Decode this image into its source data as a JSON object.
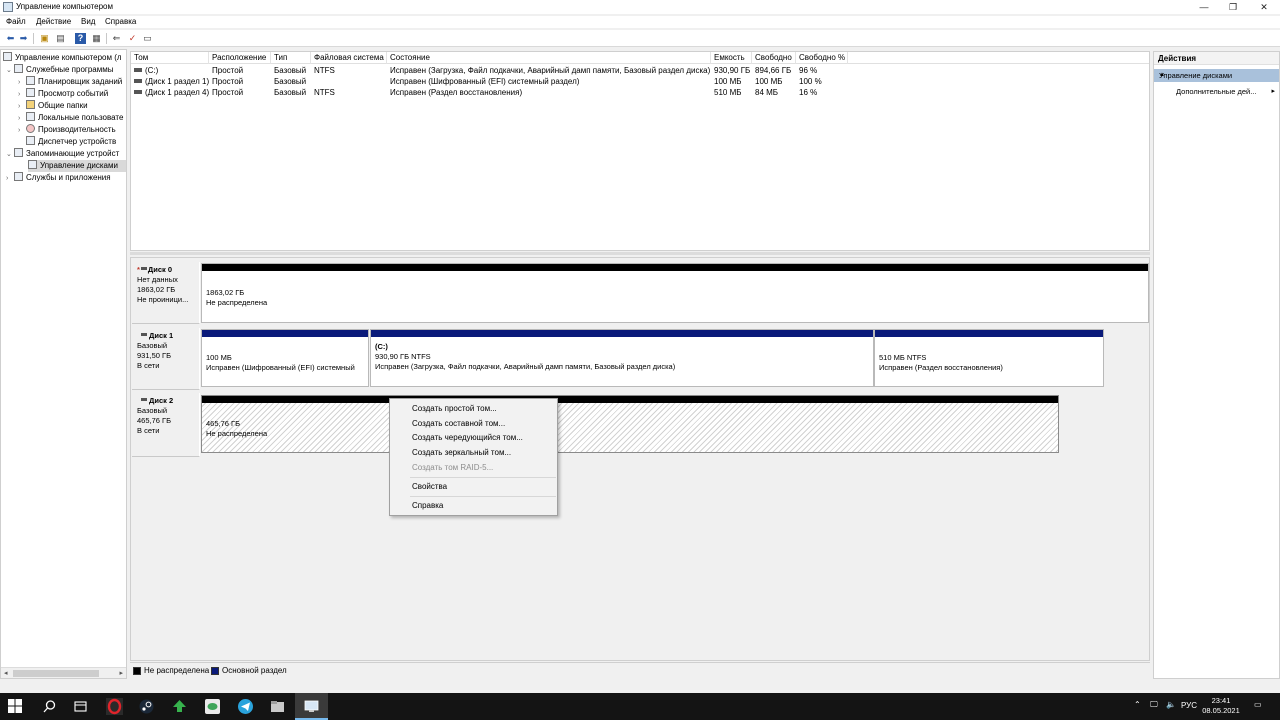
{
  "window": {
    "title": "Управление компьютером",
    "minimize": "—",
    "restore": "❐",
    "close": "✕"
  },
  "menu": [
    "Файл",
    "Действие",
    "Вид",
    "Справка"
  ],
  "tree": {
    "items": [
      {
        "label": "Управление компьютером (л",
        "icon": "computer-icon"
      },
      {
        "label": "Служебные программы",
        "icon": "tools-icon"
      },
      {
        "label": "Планировщик заданий",
        "icon": "clock-icon"
      },
      {
        "label": "Просмотр событий",
        "icon": "event-viewer-icon"
      },
      {
        "label": "Общие папки",
        "icon": "folder-icon"
      },
      {
        "label": "Локальные пользовате",
        "icon": "users-icon"
      },
      {
        "label": "Производительность",
        "icon": "performance-icon"
      },
      {
        "label": "Диспетчер устройств",
        "icon": "device-manager-icon"
      },
      {
        "label": "Запоминающие устройст",
        "icon": "storage-icon"
      },
      {
        "label": "Управление дисками",
        "icon": "disk-management-icon"
      },
      {
        "label": "Службы и приложения",
        "icon": "services-icon"
      }
    ]
  },
  "volumes": {
    "headers": [
      "Том",
      "Расположение",
      "Тип",
      "Файловая система",
      "Состояние",
      "Емкость",
      "Свободно",
      "Свободно %"
    ],
    "rows": [
      {
        "vol": "(C:)",
        "layout": "Простой",
        "type": "Базовый",
        "fs": "NTFS",
        "status": "Исправен (Загрузка, Файл подкачки, Аварийный дамп памяти, Базовый раздел диска)",
        "cap": "930,90 ГБ",
        "free": "894,66 ГБ",
        "pct": "96 %"
      },
      {
        "vol": "(Диск 1 раздел 1)",
        "layout": "Простой",
        "type": "Базовый",
        "fs": "",
        "status": "Исправен (Шифрованный (EFI) системный раздел)",
        "cap": "100 МБ",
        "free": "100 МБ",
        "pct": "100 %"
      },
      {
        "vol": "(Диск 1 раздел 4)",
        "layout": "Простой",
        "type": "Базовый",
        "fs": "NTFS",
        "status": "Исправен (Раздел восстановления)",
        "cap": "510 МБ",
        "free": "84 МБ",
        "pct": "16 %"
      }
    ]
  },
  "disks": {
    "disk0": {
      "name": "Диск 0",
      "l1": "Нет данных",
      "l2": "1863,02 ГБ",
      "l3": "Не проиници...",
      "part": {
        "size": "1863,02 ГБ",
        "status": "Не распределена"
      }
    },
    "disk1": {
      "name": "Диск 1",
      "l1": "Базовый",
      "l2": "931,50 ГБ",
      "l3": "В сети",
      "p1": {
        "size": "100 МБ",
        "status": "Исправен (Шифрованный (EFI) системный"
      },
      "p2": {
        "label": "(C:)",
        "size": "930,90 ГБ NTFS",
        "status": "Исправен (Загрузка, Файл подкачки, Аварийный дамп памяти, Базовый раздел диска)"
      },
      "p3": {
        "size": "510 МБ NTFS",
        "status": "Исправен (Раздел восстановления)"
      }
    },
    "disk2": {
      "name": "Диск 2",
      "l1": "Базовый",
      "l2": "465,76 ГБ",
      "l3": "В сети",
      "part": {
        "size": "465,76 ГБ",
        "status": "Не распределена"
      }
    }
  },
  "legend": {
    "unallocated": "Не распределена",
    "primary": "Основной раздел"
  },
  "actions": {
    "title": "Действия",
    "section": "Управление дисками",
    "more": "Дополнительные дей..."
  },
  "context_menu": {
    "simple": "Создать простой том...",
    "spanned": "Создать составной том...",
    "striped": "Создать чередующийся том...",
    "mirrored": "Создать зеркальный том...",
    "raid5": "Создать том RAID-5...",
    "properties": "Свойства",
    "help": "Справка"
  },
  "taskbar": {
    "lang": "РУС",
    "time": "23:41",
    "date": "08.05.2021"
  },
  "colors": {
    "unallocated": "#000000",
    "primary": "#0a1a7a",
    "selection": "#a9c1db"
  }
}
